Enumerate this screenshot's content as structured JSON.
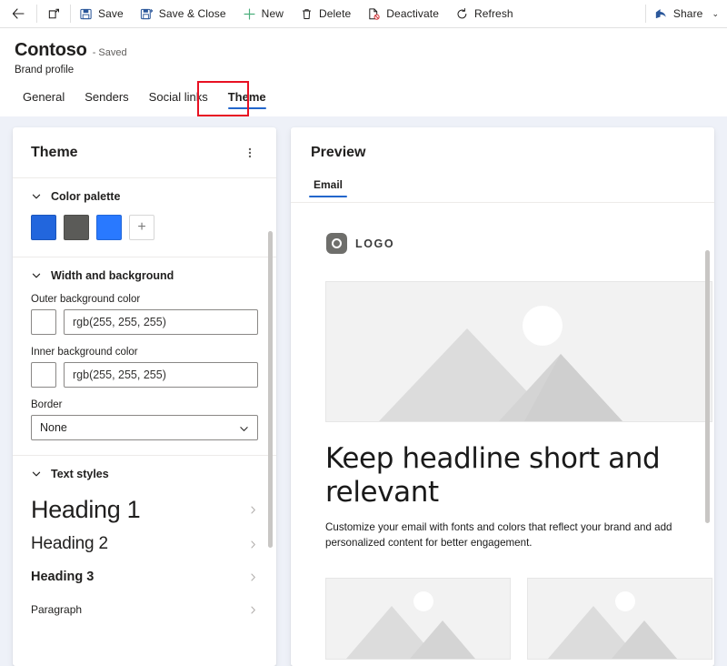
{
  "commandbar": {
    "back_icon": "arrow-left-icon",
    "popout_icon": "open-in-new-window-icon",
    "buttons": [
      {
        "label": "Save",
        "icon": "save-icon"
      },
      {
        "label": "Save & Close",
        "icon": "save-and-close-icon"
      },
      {
        "label": "New",
        "icon": "plus-icon"
      },
      {
        "label": "Delete",
        "icon": "trash-icon"
      },
      {
        "label": "Deactivate",
        "icon": "deactivate-icon"
      },
      {
        "label": "Refresh",
        "icon": "refresh-icon"
      }
    ],
    "share": {
      "label": "Share",
      "icon": "share-icon",
      "chevron": "⌄"
    }
  },
  "header": {
    "record_title": "Contoso",
    "record_status": "- Saved",
    "record_subtitle": "Brand profile",
    "tabs": [
      {
        "label": "General",
        "active": false
      },
      {
        "label": "Senders",
        "active": false
      },
      {
        "label": "Social links",
        "active": false
      },
      {
        "label": "Theme",
        "active": true
      }
    ],
    "highlight_color": "#e81123",
    "accent_color": "#2266cc"
  },
  "theme_panel": {
    "title": "Theme",
    "more_icon": "more-vertical-icon",
    "sections": {
      "color_palette": {
        "title": "Color palette",
        "chevron": "chevron-down-icon",
        "swatches": [
          {
            "name": "swatch-1",
            "color": "#2266dd"
          },
          {
            "name": "swatch-2",
            "color": "#5b5b58"
          },
          {
            "name": "swatch-3",
            "color": "#2979ff"
          }
        ],
        "add_label": "+"
      },
      "width_background": {
        "title": "Width and background",
        "chevron": "chevron-down-icon",
        "outer_bg": {
          "label": "Outer background color",
          "value": "rgb(255, 255, 255)",
          "chip_color": "#ffffff"
        },
        "inner_bg": {
          "label": "Inner background color",
          "value": "rgb(255, 255, 255)",
          "chip_color": "#ffffff"
        },
        "border": {
          "label": "Border",
          "value": "None",
          "options": [
            "None"
          ],
          "chevron": "chevron-down-icon"
        }
      },
      "text_styles": {
        "title": "Text styles",
        "chevron": "chevron-down-icon",
        "items": [
          {
            "label": "Heading 1",
            "chevron": "chevron-right-icon"
          },
          {
            "label": "Heading 2",
            "chevron": "chevron-right-icon"
          },
          {
            "label": "Heading 3",
            "chevron": "chevron-right-icon"
          },
          {
            "label": "Paragraph",
            "chevron": "chevron-right-icon"
          }
        ]
      }
    }
  },
  "preview_panel": {
    "title": "Preview",
    "tabs": [
      {
        "label": "Email",
        "active": true
      }
    ],
    "email": {
      "logo_text": "LOGO",
      "logo_icon": "logo-placeholder-icon",
      "hero_image": "image-placeholder-mountains-icon",
      "headline": "Keep headline short and relevant",
      "body": "Customize your email with fonts and colors that reflect your brand and add personalized content for better engagement.",
      "cards": [
        {
          "name": "card-1",
          "image": "image-placeholder-mountains-icon"
        },
        {
          "name": "card-2",
          "image": "image-placeholder-mountains-icon"
        }
      ]
    }
  }
}
